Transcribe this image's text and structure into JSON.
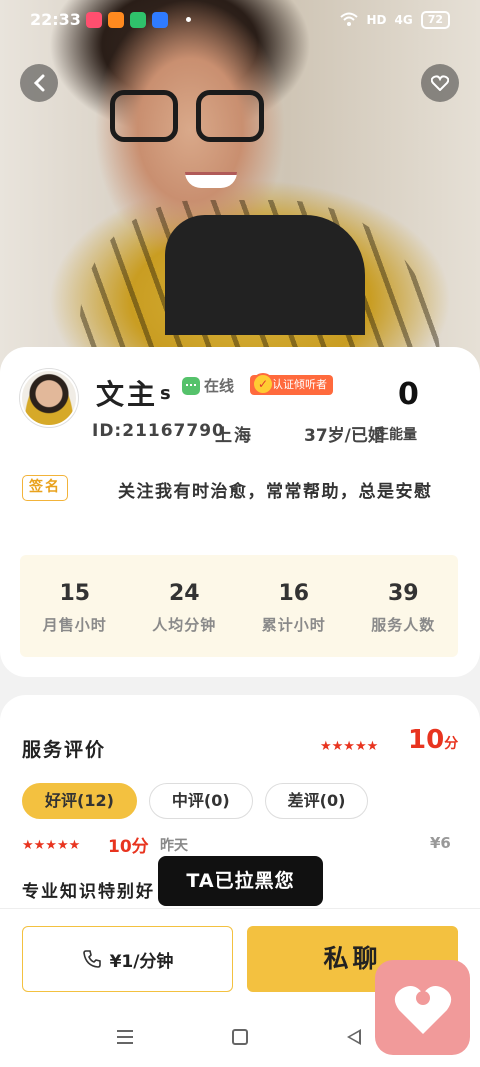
{
  "status_bar": {
    "time": "22:33",
    "signal": "4G",
    "hd": "HD",
    "battery": "72"
  },
  "profile": {
    "name": "文主",
    "name_suffix": "s",
    "online_label": "在线",
    "cert_label": "认证倾听者",
    "id_text": "ID:21167790",
    "city": "上海",
    "age_status": "37岁/已婚",
    "energy_value": "0",
    "energy_label": "正能量",
    "sign_tag": "签名",
    "sign_text": "关注我有时治愈，常常帮助，总是安慰"
  },
  "stats": [
    {
      "value": "15",
      "label": "月售小时"
    },
    {
      "value": "24",
      "label": "人均分钟"
    },
    {
      "value": "16",
      "label": "累计小时"
    },
    {
      "value": "39",
      "label": "服务人数"
    }
  ],
  "reviews": {
    "title": "服务评价",
    "rating_stars": 5,
    "score": "10",
    "score_unit": "分",
    "tabs": [
      {
        "label": "好评(12)",
        "active": true
      },
      {
        "label": "中评(0)",
        "active": false
      },
      {
        "label": "差评(0)",
        "active": false
      }
    ],
    "item": {
      "stars": 5,
      "score": "10分",
      "time": "昨天",
      "price": "¥6",
      "content": "专业知识特别好"
    }
  },
  "toast": "TA已拉黑您",
  "actions": {
    "call_label": "¥1/分钟",
    "chat_label": "私聊"
  },
  "icons": [
    "back-icon",
    "heart-icon",
    "phone-icon",
    "floating-heart-icon",
    "menu-icon",
    "home-icon",
    "back-nav-icon"
  ],
  "colors": {
    "accent": "#f3c140",
    "rating": "#e8341f",
    "online": "#55c26b",
    "cert": "#ff6a3d"
  }
}
